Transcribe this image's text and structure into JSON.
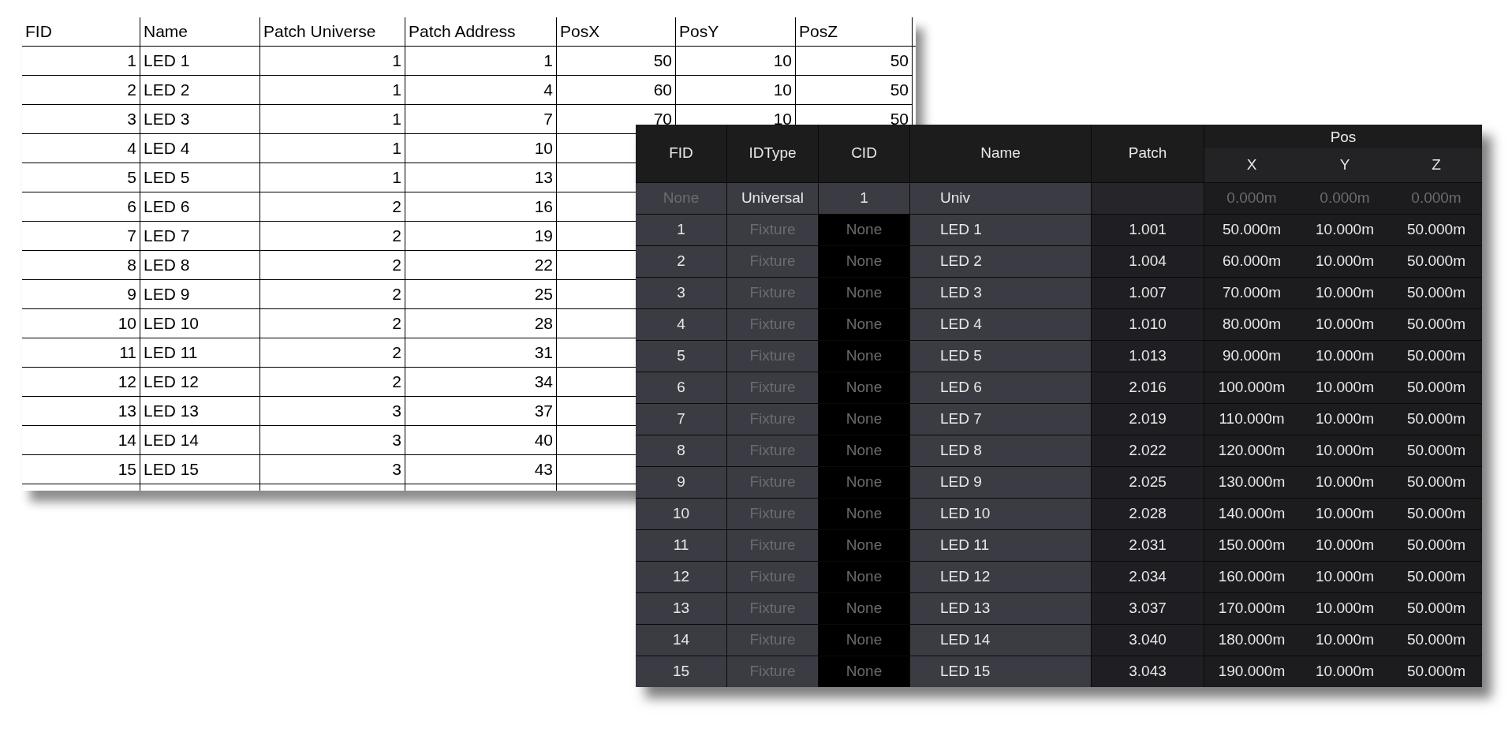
{
  "spreadsheet": {
    "columns": [
      "FID",
      "Name",
      "Patch Universe",
      "Patch Address",
      "PosX",
      "PosY",
      "PosZ"
    ],
    "rows": [
      {
        "cells": [
          "1",
          "LED 1",
          "1",
          "1",
          "50",
          "10",
          "50"
        ]
      },
      {
        "cells": [
          "2",
          "LED 2",
          "1",
          "4",
          "60",
          "10",
          "50"
        ]
      },
      {
        "cells": [
          "3",
          "LED 3",
          "1",
          "7",
          "70",
          "10",
          "50"
        ]
      },
      {
        "cells": [
          "4",
          "LED 4",
          "1",
          "10"
        ]
      },
      {
        "cells": [
          "5",
          "LED 5",
          "1",
          "13"
        ]
      },
      {
        "cells": [
          "6",
          "LED 6",
          "2",
          "16"
        ]
      },
      {
        "cells": [
          "7",
          "LED 7",
          "2",
          "19"
        ]
      },
      {
        "cells": [
          "8",
          "LED 8",
          "2",
          "22"
        ]
      },
      {
        "cells": [
          "9",
          "LED 9",
          "2",
          "25"
        ]
      },
      {
        "cells": [
          "10",
          "LED 10",
          "2",
          "28"
        ]
      },
      {
        "cells": [
          "11",
          "LED 11",
          "2",
          "31"
        ]
      },
      {
        "cells": [
          "12",
          "LED 12",
          "2",
          "34"
        ]
      },
      {
        "cells": [
          "13",
          "LED 13",
          "3",
          "37"
        ]
      },
      {
        "cells": [
          "14",
          "LED 14",
          "3",
          "40"
        ]
      },
      {
        "cells": [
          "15",
          "LED 15",
          "3",
          "43"
        ]
      }
    ]
  },
  "patch_table": {
    "columns": [
      "FID",
      "IDType",
      "CID",
      "Name",
      "Patch"
    ],
    "pos_group": {
      "label": "Pos",
      "columns": [
        "X",
        "Y",
        "Z"
      ]
    },
    "rows": [
      {
        "kind": "universe",
        "fid": "None",
        "idtype": "Universal",
        "cid": "1",
        "name": "Univ",
        "x": "0.000m",
        "y": "0.000m",
        "z": "0.000m"
      },
      {
        "kind": "fixture",
        "fid": "1",
        "idtype": "Fixture",
        "cid": "None",
        "name": "LED 1",
        "patch": "1.001",
        "x": "50.000m",
        "y": "10.000m",
        "z": "50.000m"
      },
      {
        "kind": "fixture",
        "fid": "2",
        "idtype": "Fixture",
        "cid": "None",
        "name": "LED 2",
        "patch": "1.004",
        "x": "60.000m",
        "y": "10.000m",
        "z": "50.000m"
      },
      {
        "kind": "fixture",
        "fid": "3",
        "idtype": "Fixture",
        "cid": "None",
        "name": "LED 3",
        "patch": "1.007",
        "x": "70.000m",
        "y": "10.000m",
        "z": "50.000m"
      },
      {
        "kind": "fixture",
        "fid": "4",
        "idtype": "Fixture",
        "cid": "None",
        "name": "LED 4",
        "patch": "1.010",
        "x": "80.000m",
        "y": "10.000m",
        "z": "50.000m"
      },
      {
        "kind": "fixture",
        "fid": "5",
        "idtype": "Fixture",
        "cid": "None",
        "name": "LED 5",
        "patch": "1.013",
        "x": "90.000m",
        "y": "10.000m",
        "z": "50.000m"
      },
      {
        "kind": "fixture",
        "fid": "6",
        "idtype": "Fixture",
        "cid": "None",
        "name": "LED 6",
        "patch": "2.016",
        "x": "100.000m",
        "y": "10.000m",
        "z": "50.000m"
      },
      {
        "kind": "fixture",
        "fid": "7",
        "idtype": "Fixture",
        "cid": "None",
        "name": "LED 7",
        "patch": "2.019",
        "x": "110.000m",
        "y": "10.000m",
        "z": "50.000m"
      },
      {
        "kind": "fixture",
        "fid": "8",
        "idtype": "Fixture",
        "cid": "None",
        "name": "LED 8",
        "patch": "2.022",
        "x": "120.000m",
        "y": "10.000m",
        "z": "50.000m"
      },
      {
        "kind": "fixture",
        "fid": "9",
        "idtype": "Fixture",
        "cid": "None",
        "name": "LED 9",
        "patch": "2.025",
        "x": "130.000m",
        "y": "10.000m",
        "z": "50.000m"
      },
      {
        "kind": "fixture",
        "fid": "10",
        "idtype": "Fixture",
        "cid": "None",
        "name": "LED 10",
        "patch": "2.028",
        "x": "140.000m",
        "y": "10.000m",
        "z": "50.000m"
      },
      {
        "kind": "fixture",
        "fid": "11",
        "idtype": "Fixture",
        "cid": "None",
        "name": "LED 11",
        "patch": "2.031",
        "x": "150.000m",
        "y": "10.000m",
        "z": "50.000m"
      },
      {
        "kind": "fixture",
        "fid": "12",
        "idtype": "Fixture",
        "cid": "None",
        "name": "LED 12",
        "patch": "2.034",
        "x": "160.000m",
        "y": "10.000m",
        "z": "50.000m"
      },
      {
        "kind": "fixture",
        "fid": "13",
        "idtype": "Fixture",
        "cid": "None",
        "name": "LED 13",
        "patch": "3.037",
        "x": "170.000m",
        "y": "10.000m",
        "z": "50.000m"
      },
      {
        "kind": "fixture",
        "fid": "14",
        "idtype": "Fixture",
        "cid": "None",
        "name": "LED 14",
        "patch": "3.040",
        "x": "180.000m",
        "y": "10.000m",
        "z": "50.000m"
      },
      {
        "kind": "fixture",
        "fid": "15",
        "idtype": "Fixture",
        "cid": "None",
        "name": "LED 15",
        "patch": "3.043",
        "x": "190.000m",
        "y": "10.000m",
        "z": "50.000m"
      }
    ]
  }
}
